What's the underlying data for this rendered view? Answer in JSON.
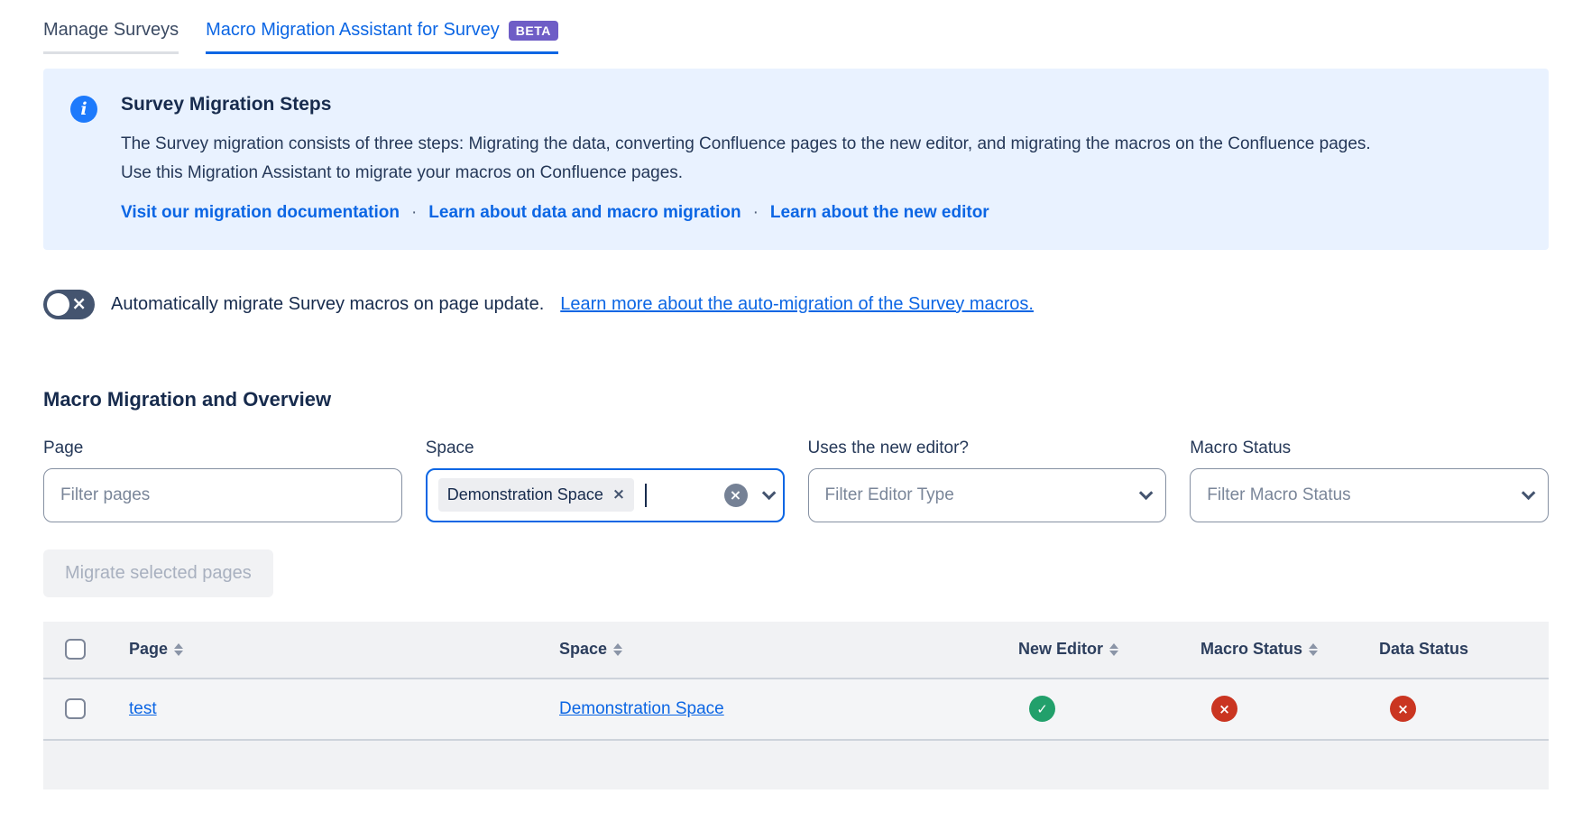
{
  "colors": {
    "accent": "#0C66E4",
    "info_panel_bg": "#E9F2FF",
    "info_icon_bg": "#1D7AFC",
    "beta_badge_bg": "#6E5DC6",
    "success": "#22A06B",
    "error": "#CA3521",
    "toggle_off_bg": "#44546F",
    "table_bg": "#F1F2F4"
  },
  "icons": {
    "info": "i",
    "check": "✓",
    "cross": "×",
    "chevron_down": "chevron-down",
    "sort": "sort-arrows"
  },
  "tabs": [
    {
      "label": "Manage Surveys",
      "active": false
    },
    {
      "label": "Macro Migration Assistant for Survey",
      "badge": "BETA",
      "active": true
    }
  ],
  "info_panel": {
    "title": "Survey Migration Steps",
    "body": "The Survey migration consists of three steps: Migrating the data, converting Confluence pages to the new editor, and migrating the macros on the Confluence pages. Use this Migration Assistant to migrate your macros on Confluence pages.",
    "separator": "·",
    "links": [
      {
        "label": "Visit our migration documentation"
      },
      {
        "label": "Learn about data and macro migration"
      },
      {
        "label": "Learn about the new editor"
      }
    ]
  },
  "auto_migrate": {
    "toggle_state": "off",
    "text": "Automatically migrate Survey macros on page update.",
    "link": "Learn more about the auto-migration of the Survey macros."
  },
  "section": {
    "title": "Macro Migration and Overview"
  },
  "filters": {
    "page": {
      "label": "Page",
      "placeholder": "Filter pages",
      "value": ""
    },
    "space": {
      "label": "Space",
      "selected_chips": [
        "Demonstration Space"
      ],
      "focused": true
    },
    "editor": {
      "label": "Uses the new editor?",
      "placeholder": "Filter Editor Type"
    },
    "macro_status": {
      "label": "Macro Status",
      "placeholder": "Filter Macro Status"
    }
  },
  "actions": {
    "migrate_button": {
      "label": "Migrate selected pages",
      "disabled": true
    }
  },
  "table": {
    "headers": [
      {
        "label": "Page",
        "sortable": true
      },
      {
        "label": "Space",
        "sortable": true
      },
      {
        "label": "New Editor",
        "sortable": true
      },
      {
        "label": "Macro Status",
        "sortable": true
      },
      {
        "label": "Data Status",
        "sortable": false
      }
    ],
    "rows": [
      {
        "page": "test",
        "space": "Demonstration Space",
        "new_editor": "success",
        "macro_status": "error",
        "data_status": "error"
      }
    ]
  }
}
